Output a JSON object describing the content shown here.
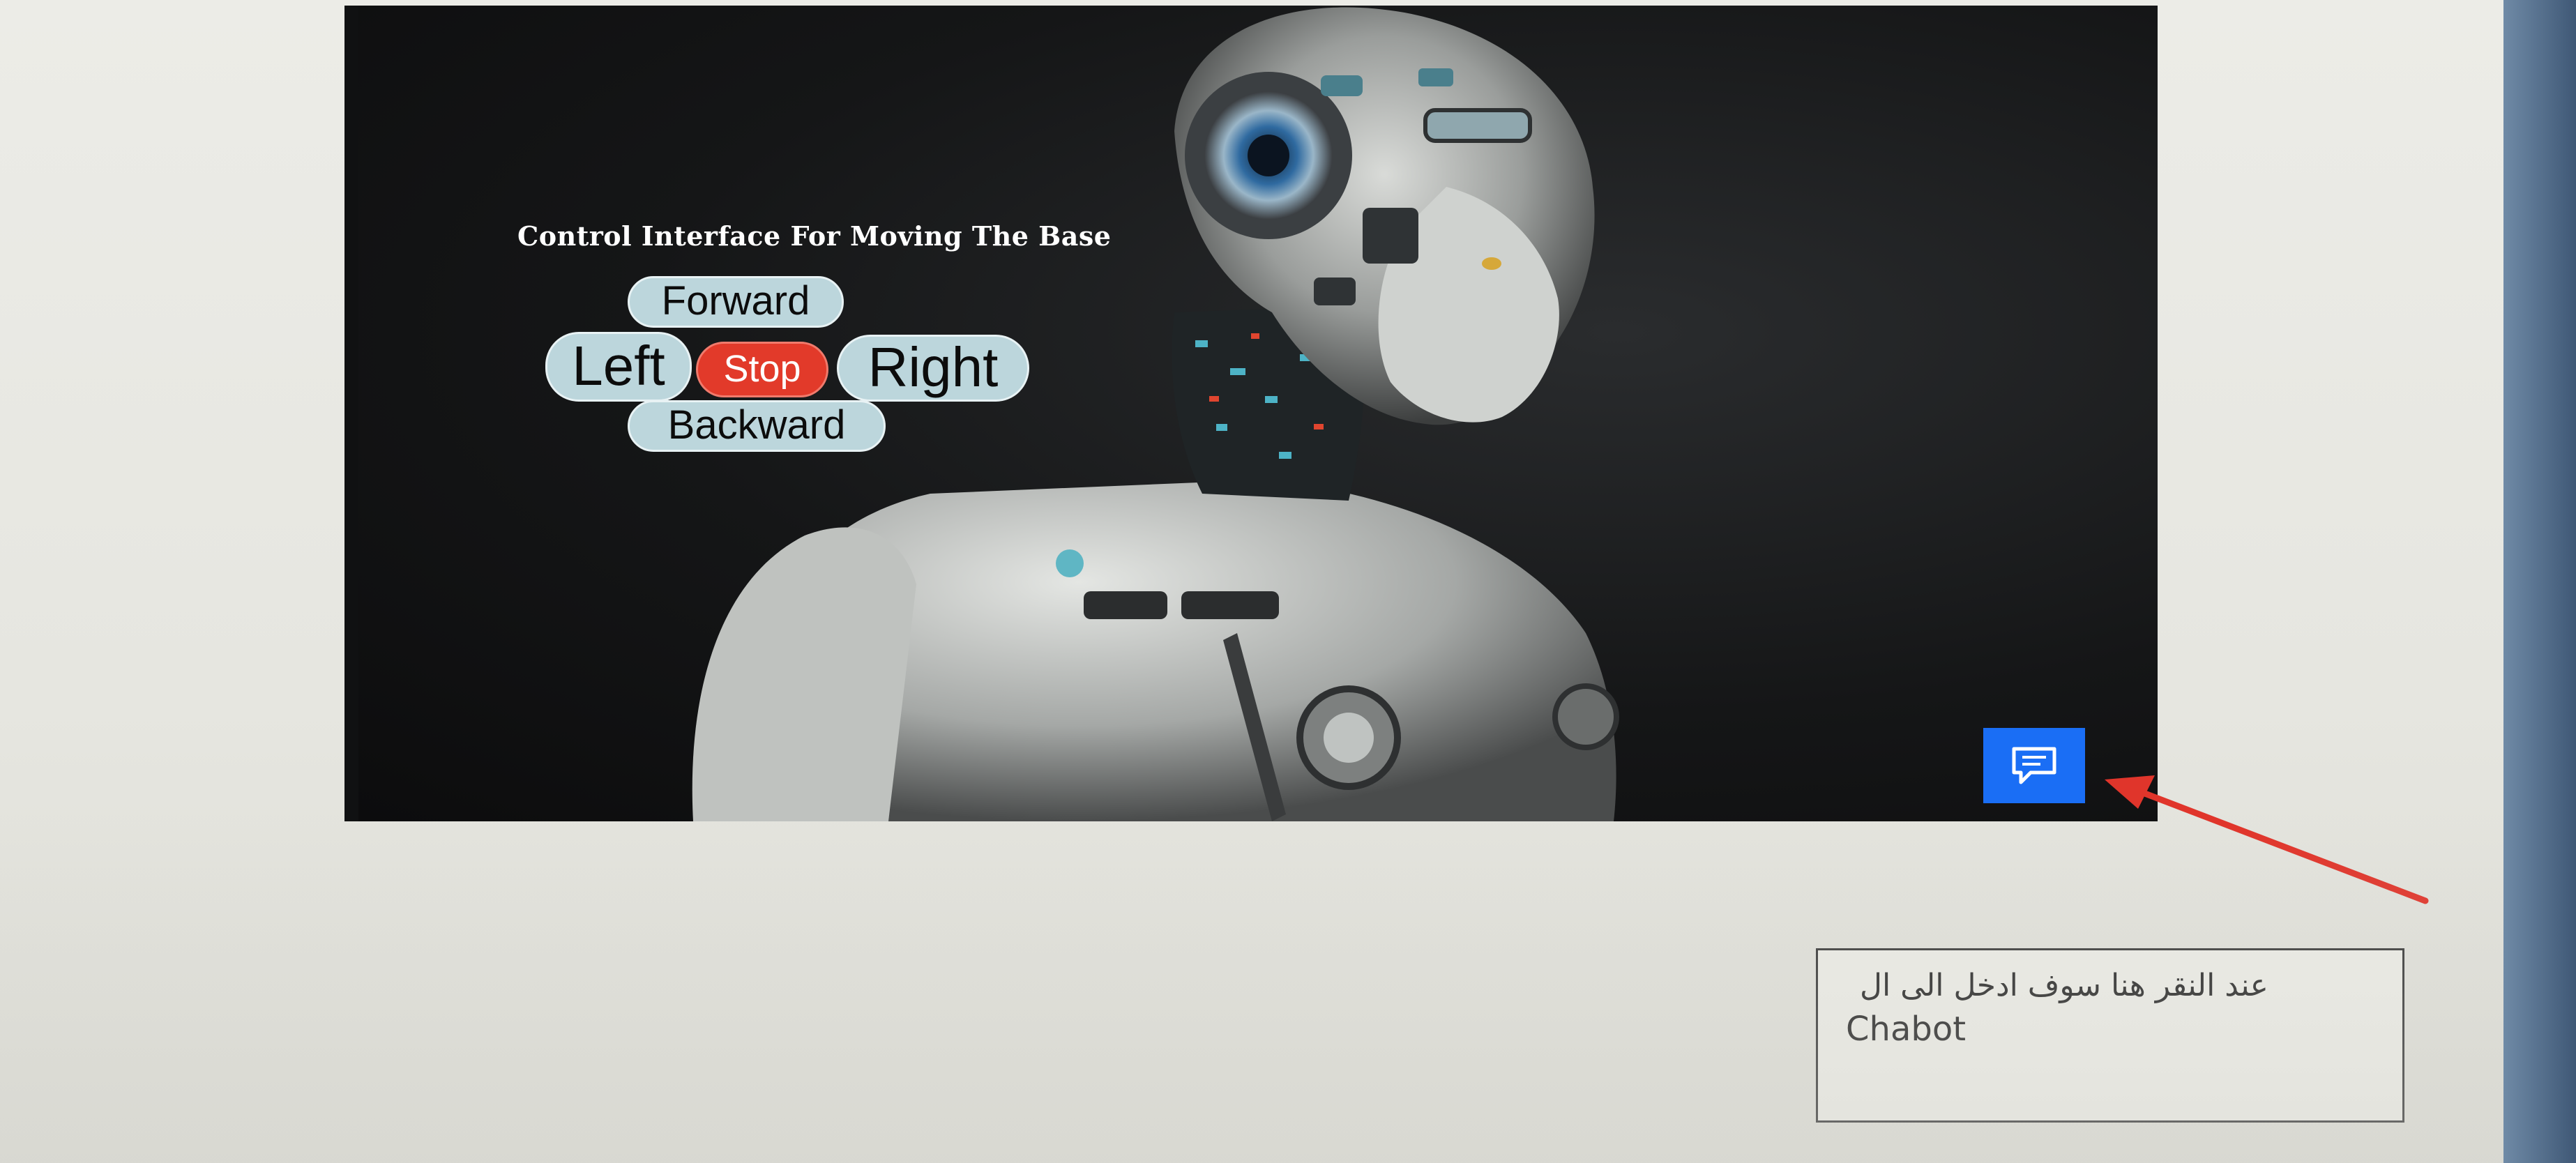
{
  "hero": {
    "title": "Control Interface For Moving The Base",
    "controls": {
      "forward": "Forward",
      "left": "Left",
      "stop": "Stop",
      "right": "Right",
      "backward": "Backward"
    },
    "chat_button_icon": "chat-icon"
  },
  "note": {
    "arabic_text": "عند النقر هنا سوف ادخل الى ال",
    "latin_text": "Chabot"
  },
  "colors": {
    "chat_button": "#1a6ef5",
    "stop_button": "#e23a2a",
    "direction_button": "#bcd6dc",
    "annotation_arrow": "#e0352b"
  }
}
